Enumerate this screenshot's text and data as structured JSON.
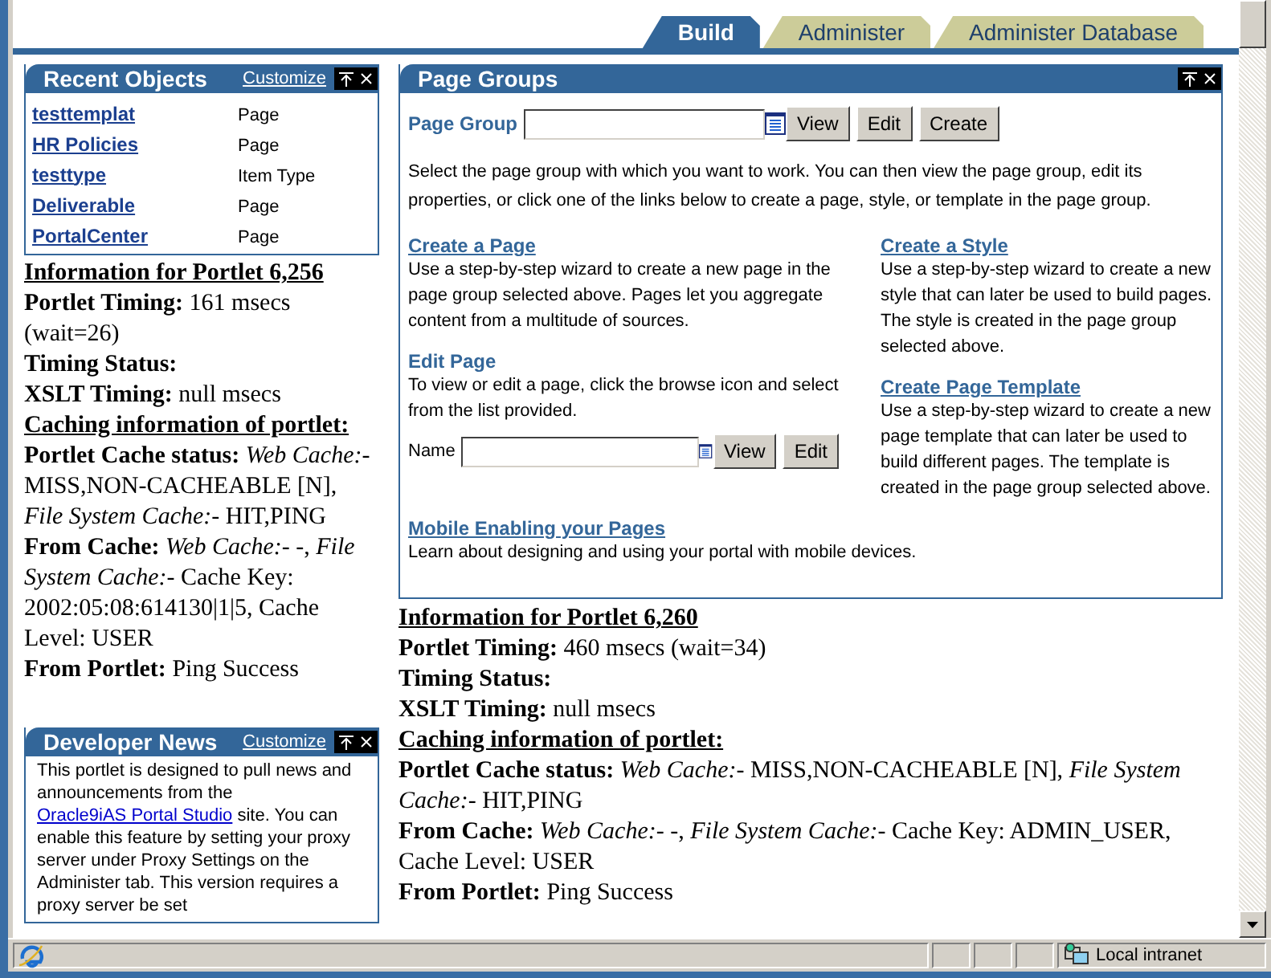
{
  "tabs": [
    {
      "label": "Build",
      "selected": true
    },
    {
      "label": "Administer",
      "selected": false
    },
    {
      "label": "Administer Database",
      "selected": false
    }
  ],
  "recent_objects": {
    "title": "Recent Objects",
    "customize": "Customize",
    "items": [
      {
        "name": "testtemplat",
        "type": "Page"
      },
      {
        "name": "HR Policies",
        "type": "Page"
      },
      {
        "name": "testtype",
        "type": "Item Type"
      },
      {
        "name": "Deliverable",
        "type": "Page"
      },
      {
        "name": "PortalCenter",
        "type": "Page"
      }
    ]
  },
  "portlet_info_left": {
    "lines": [
      {
        "kind": "heading",
        "text": "Information for Portlet 6,256"
      },
      {
        "kind": "line",
        "text": "**Portlet Timing:** 161 msecs (wait=26)"
      },
      {
        "kind": "line",
        "text": "**Timing Status:**"
      },
      {
        "kind": "line",
        "text": "**XSLT Timing:** null msecs"
      },
      {
        "kind": "heading",
        "text": "Caching information of portlet:"
      },
      {
        "kind": "line",
        "text": "**Portlet Cache status:** *Web Cache:*- MISS,NON-CACHEABLE [N], *File System Cache:*- HIT,PING"
      },
      {
        "kind": "line",
        "text": "**From Cache:** *Web Cache:*- -, *File System Cache:*- Cache Key: 2002:05:08:614130|1|5, Cache Level: USER"
      },
      {
        "kind": "line",
        "text": "**From Portlet:** Ping Success"
      }
    ]
  },
  "developer_news": {
    "title": "Developer News",
    "customize": "Customize",
    "text_before": "This portlet is designed to pull news and announcements from the ",
    "link": "Oracle9iAS Portal Studio",
    "text_after": " site. You can enable this feature by setting your proxy server under Proxy Settings on the Administer tab. This version requires a proxy server be set"
  },
  "page_groups": {
    "title": "Page Groups",
    "field_label": "Page Group",
    "buttons": [
      "View",
      "Edit",
      "Create"
    ],
    "intro": "Select the page group with which you want to work. You can then view the page group, edit its properties, or click one of the links below to create a page, style, or template in the page group.",
    "left_sections": [
      {
        "kind": "link",
        "title": "Create a Page",
        "description": "Use a step-by-step wizard to create a new page in the page group selected above. Pages let you aggregate content from a multitude of sources."
      },
      {
        "kind": "form",
        "title": "Edit Page",
        "description": "To view or edit a page, click the browse icon and select from the list provided.",
        "field_label": "Name",
        "buttons": [
          "View",
          "Edit"
        ]
      }
    ],
    "right_sections": [
      {
        "kind": "link",
        "title": "Create a Style",
        "description": "Use a step-by-step wizard to create a new style that can later be used to build pages. The style is created in the page group selected above."
      },
      {
        "kind": "link",
        "title": "Create Page Template",
        "description": "Use a step-by-step wizard to create a new page template that can later be used to build different pages. The template is created in the page group selected above."
      }
    ],
    "footer_sections": [
      {
        "kind": "link",
        "title": "Mobile Enabling your Pages",
        "description": "Learn about designing and using your portal with mobile devices."
      }
    ]
  },
  "portlet_info_right": {
    "lines": [
      {
        "kind": "heading",
        "text": "Information for Portlet 6,260"
      },
      {
        "kind": "line",
        "text": "**Portlet Timing:** 460 msecs (wait=34)"
      },
      {
        "kind": "line",
        "text": "**Timing Status:**"
      },
      {
        "kind": "line",
        "text": "**XSLT Timing:** null msecs"
      },
      {
        "kind": "heading",
        "text": "Caching information of portlet:"
      },
      {
        "kind": "line",
        "text": "**Portlet Cache status:** *Web Cache:*- MISS,NON-CACHEABLE [N], *File System Cache:*- HIT,PING"
      },
      {
        "kind": "line",
        "text": "**From Cache:** *Web Cache:*- -, *File System Cache:*- Cache Key: ADMIN_USER, Cache Level: USER"
      },
      {
        "kind": "line",
        "text": "**From Portlet:** Ping Success"
      }
    ]
  },
  "status_bar": {
    "zone": "Local intranet"
  }
}
